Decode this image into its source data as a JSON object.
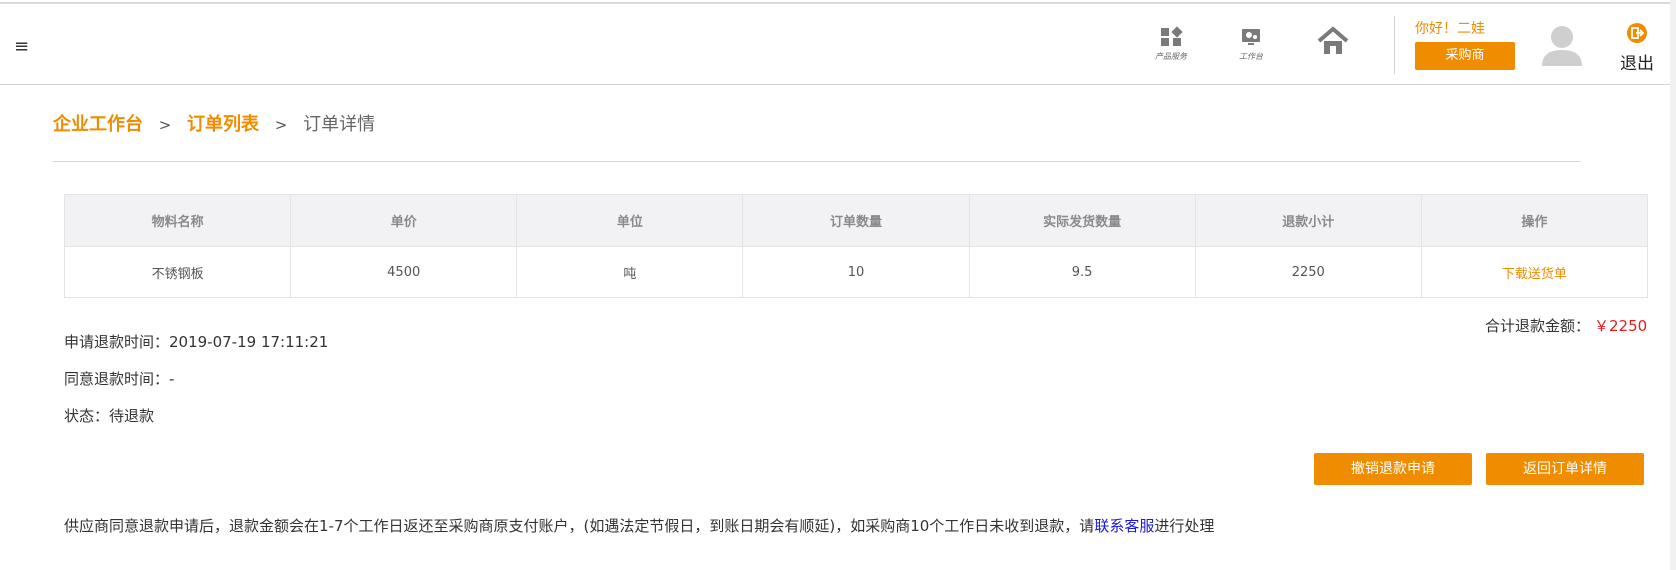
{
  "header": {
    "menu_icon": "hamburger-icon",
    "nav": [
      {
        "label": "产品服务",
        "icon": "grid-icon"
      },
      {
        "label": "工作台",
        "icon": "workbench-icon"
      },
      {
        "label": "首页",
        "icon": "home-icon"
      }
    ],
    "greeting": "你好！二娃",
    "role_button": "采购商",
    "avatar_icon": "user-avatar-icon",
    "logout_label": "退出",
    "logout_icon": "logout-icon"
  },
  "breadcrumb": {
    "items": [
      "企业工作台",
      "订单列表",
      "订单详情"
    ],
    "separator": ">"
  },
  "table": {
    "columns": [
      "物料名称",
      "单价",
      "单位",
      "订单数量",
      "实际发货数量",
      "退款小计",
      "操作"
    ],
    "rows": [
      [
        "不锈钢板",
        "4500",
        "吨",
        "10",
        "9.5",
        "2250",
        "下载送货单"
      ]
    ]
  },
  "summary": {
    "total_label": "合计退款金额：",
    "total_amount": "￥2250"
  },
  "refund_info": {
    "apply_time": "申请退款时间：2019-07-19 17:11:21",
    "agree_time": "同意退款时间：-",
    "status": "状态：待退款"
  },
  "actions": {
    "cancel_button": "撤销退款申请",
    "back_button": "返回订单详情"
  },
  "notice": {
    "text": "供应商同意退款申请后，退款金额会在1-7个工作日返还至采购商原支付账户，(如遇法定节假日，到账日期会有顺延)，如采购商10个工作日未收到退款，请",
    "link": "联系客服",
    "suffix": "进行处理"
  },
  "colors": {
    "accent": "#f08c00",
    "amount": "#e81c1c",
    "link": "#1a1adb"
  }
}
